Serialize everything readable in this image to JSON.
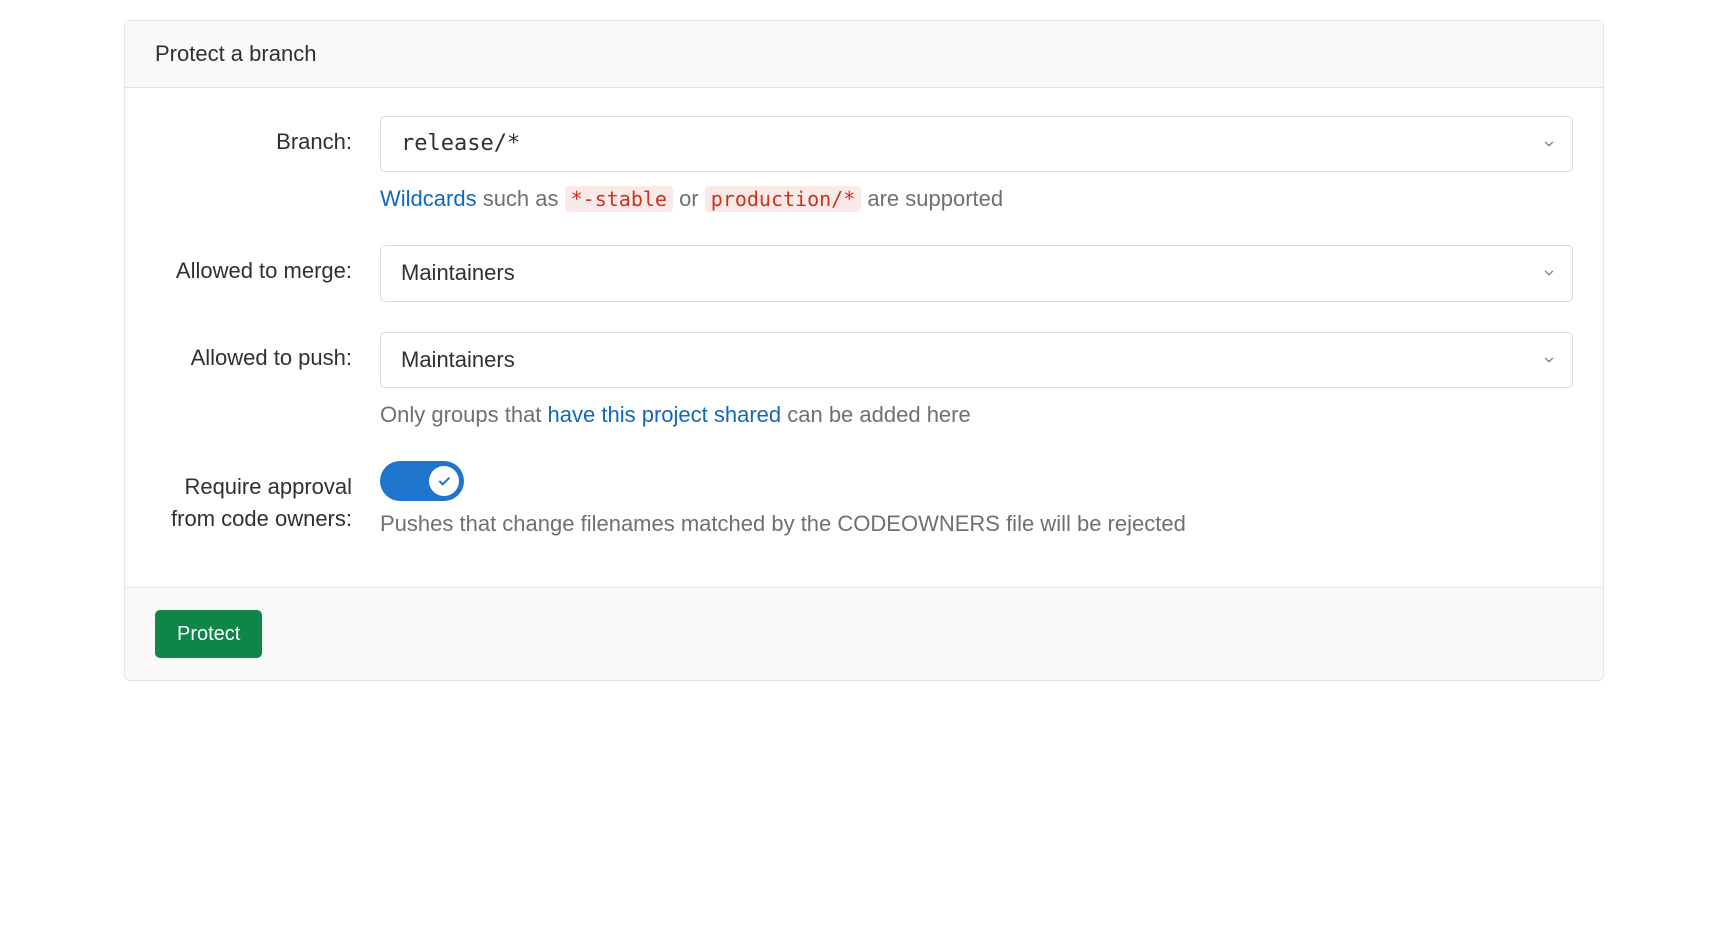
{
  "header": {
    "title": "Protect a branch"
  },
  "form": {
    "branch": {
      "label": "Branch:",
      "value": "release/*",
      "hint_prefix": "Wildcards",
      "hint_middle1": " such as ",
      "hint_code1": "*-stable",
      "hint_middle2": " or ",
      "hint_code2": "production/*",
      "hint_suffix": " are supported"
    },
    "merge": {
      "label": "Allowed to merge:",
      "value": "Maintainers"
    },
    "push": {
      "label": "Allowed to push:",
      "value": "Maintainers",
      "hint_prefix": "Only groups that ",
      "hint_link": "have this project shared",
      "hint_suffix": " can be added here"
    },
    "codeowners": {
      "label": "Require approval from code owners:",
      "description": "Pushes that change filenames matched by the CODEOWNERS file will be rejected"
    }
  },
  "footer": {
    "submit_label": "Protect"
  }
}
